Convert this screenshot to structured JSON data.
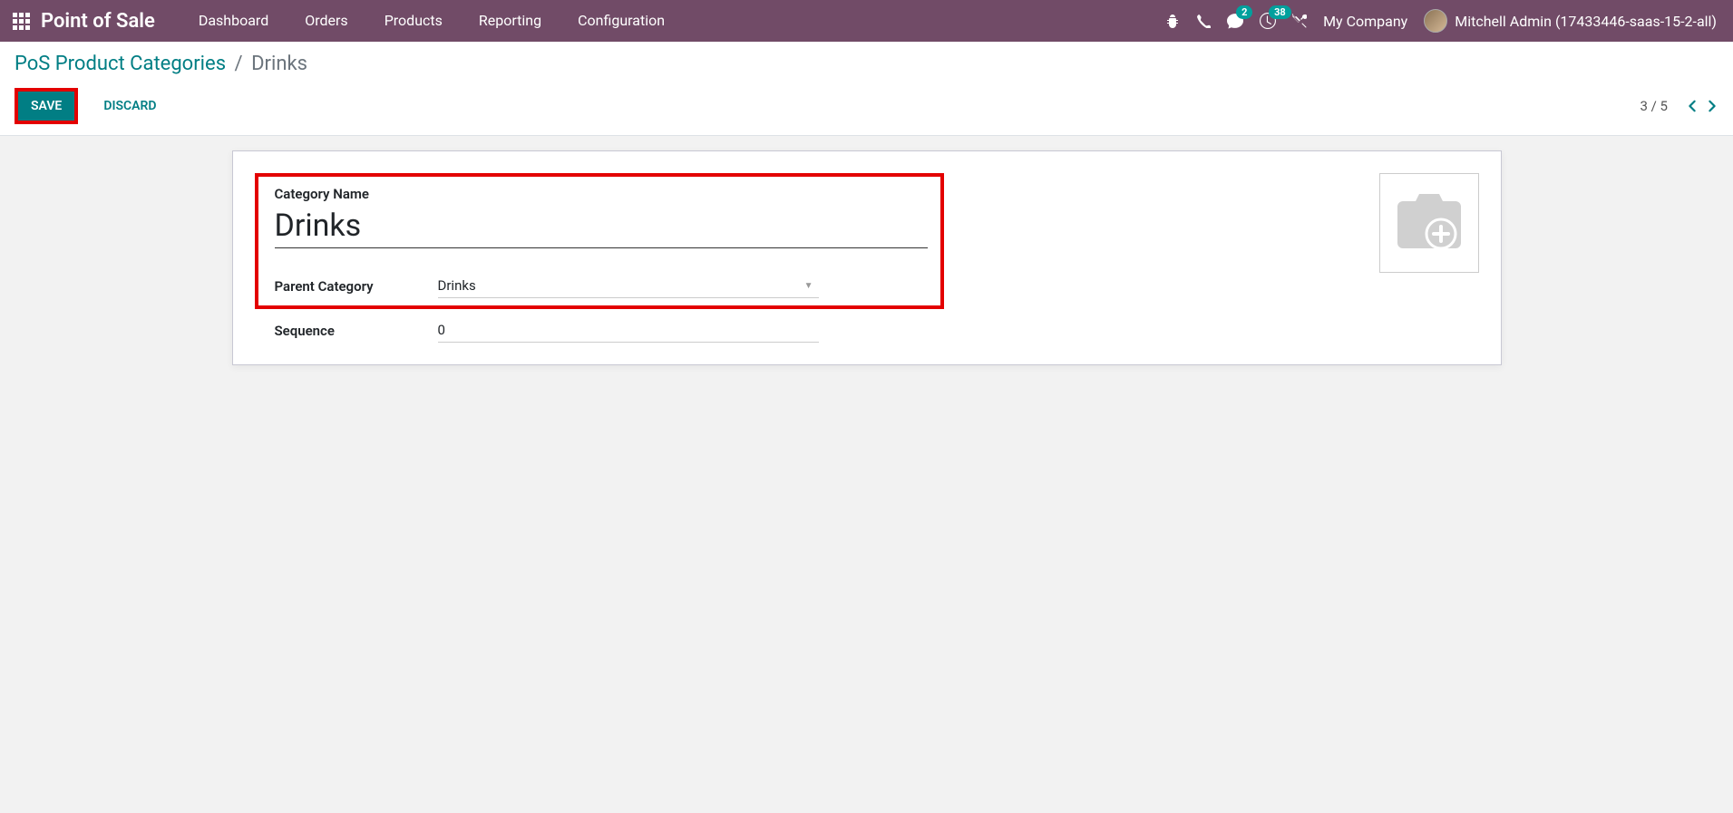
{
  "header": {
    "brand": "Point of Sale",
    "menu": [
      "Dashboard",
      "Orders",
      "Products",
      "Reporting",
      "Configuration"
    ],
    "messages_badge": "2",
    "activities_badge": "38",
    "company": "My Company",
    "user": "Mitchell Admin (17433446-saas-15-2-all)"
  },
  "breadcrumb": {
    "parent": "PoS Product Categories",
    "current": "Drinks"
  },
  "actions": {
    "save": "SAVE",
    "discard": "DISCARD"
  },
  "pager": {
    "value": "3 / 5"
  },
  "form": {
    "category_name_label": "Category Name",
    "category_name_value": "Drinks",
    "parent_category_label": "Parent Category",
    "parent_category_value": "Drinks",
    "sequence_label": "Sequence",
    "sequence_value": "0"
  }
}
